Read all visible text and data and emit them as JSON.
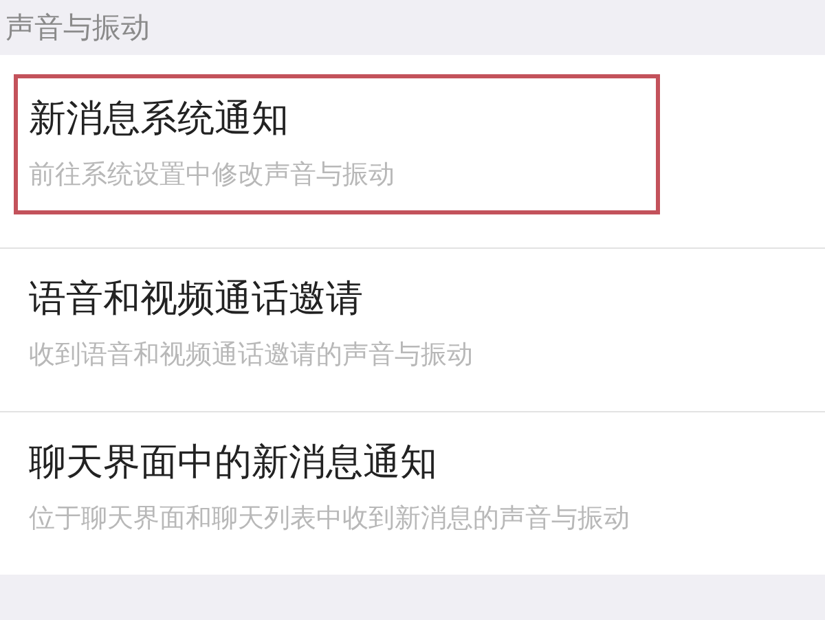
{
  "section_title": "声音与振动",
  "items": [
    {
      "title": "新消息系统通知",
      "subtitle": "前往系统设置中修改声音与振动",
      "highlighted": true
    },
    {
      "title": "语音和视频通话邀请",
      "subtitle": "收到语音和视频通话邀请的声音与振动",
      "highlighted": false
    },
    {
      "title": "聊天界面中的新消息通知",
      "subtitle": "位于聊天界面和聊天列表中收到新消息的声音与振动",
      "highlighted": false
    }
  ]
}
